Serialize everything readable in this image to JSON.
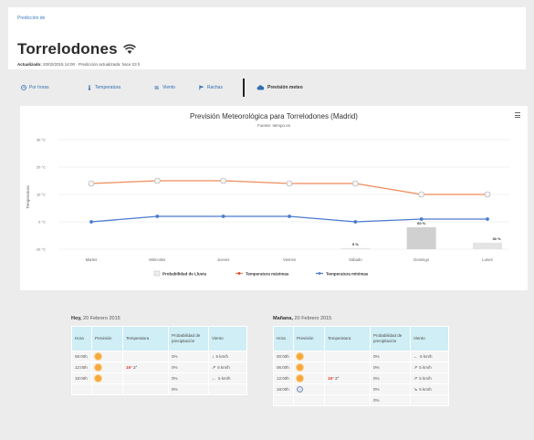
{
  "header": {
    "breadcrumb": "Predicción de",
    "title": "Torrelodones",
    "subtitle_prefix": "Actualizado: ",
    "subtitle_rest": "20/02/2015 14:00 · Predicción actualizada: hace 23 h"
  },
  "tabs": [
    {
      "label": "Por horas",
      "icon": "clock-icon"
    },
    {
      "label": "Temperatura",
      "icon": "thermometer-icon"
    },
    {
      "label": "Viento",
      "icon": "wind-icon"
    },
    {
      "label": "Rachas",
      "icon": "flag-icon"
    },
    {
      "label": "Previsión meteo",
      "icon": "cloud-icon",
      "active": true
    }
  ],
  "chart_data": {
    "type": "line",
    "title": "Previsión Meteorológica para Torrelodones (Madrid)",
    "subtitle": "Fuente: tiempo.es",
    "ylabel": "Temperatura",
    "ylim": [
      -10,
      30
    ],
    "yticks": [
      "30 °C",
      "20 °C",
      "10 °C",
      "0 °C",
      "-10 °C"
    ],
    "categories": [
      "Martes",
      "Miércoles",
      "Jueves",
      "Viernes",
      "Sábado",
      "Domingo",
      "Lunes"
    ],
    "series": [
      {
        "name": "Temperatura máximas",
        "color": "#f08b5a",
        "values": [
          14,
          15,
          15,
          14,
          14,
          10,
          10
        ]
      },
      {
        "name": "Temperatura mínimas",
        "color": "#4a7bd0",
        "values": [
          0,
          2,
          2,
          2,
          0,
          1,
          1
        ]
      }
    ],
    "precipitation": {
      "name": "Probabilidad de Lluvia",
      "values": [
        0,
        0,
        0,
        0,
        5,
        100,
        30
      ],
      "labels": [
        "",
        "",
        "",
        "",
        "5 %",
        "60 %",
        "30 %"
      ]
    },
    "grid": true,
    "legend": "bottom"
  },
  "forecast": {
    "today": {
      "title_bold": "Hoy,",
      "title_rest": " 20 Febrero 2015",
      "headers": [
        "Hora",
        "Previsión",
        "Temperatura",
        "Probabilidad de precipitación",
        "Viento"
      ],
      "rows": [
        {
          "hora": "06:00h",
          "icon": "sun-icon",
          "temp_max": "",
          "temp_min": "",
          "prob": "0%",
          "arrow": "↓",
          "wind": "5 km/h"
        },
        {
          "hora": "12:00h",
          "icon": "sun-icon",
          "temp_max": "16°",
          "temp_min": "2°",
          "prob": "0%",
          "arrow": "↗",
          "wind": "5 km/h"
        },
        {
          "hora": "18:00h",
          "icon": "sun-icon",
          "temp_max": "",
          "temp_min": "",
          "prob": "0%",
          "arrow": "←",
          "wind": "5 km/h"
        },
        {
          "hora": "",
          "icon": "",
          "temp_max": "",
          "temp_min": "",
          "prob": "0%",
          "arrow": "",
          "wind": ""
        }
      ]
    },
    "tomorrow": {
      "title_bold": "Mañana,",
      "title_rest": " 20 Febrero 2015",
      "headers": [
        "Hora",
        "Previsión",
        "Temperatura",
        "Probabilidad de precipitación",
        "Viento"
      ],
      "rows": [
        {
          "hora": "00:00h",
          "icon": "sun-icon",
          "temp_max": "",
          "temp_min": "",
          "prob": "0%",
          "arrow": "←",
          "wind": "5 km/h"
        },
        {
          "hora": "06:00h",
          "icon": "sun-icon",
          "temp_max": "",
          "temp_min": "",
          "prob": "0%",
          "arrow": "↗",
          "wind": "5 km/h"
        },
        {
          "hora": "12:00h",
          "icon": "sun-icon",
          "temp_max": "16°",
          "temp_min": "2°",
          "prob": "0%",
          "arrow": "↗",
          "wind": "5 km/h"
        },
        {
          "hora": "18:00h",
          "icon": "moon-icon",
          "temp_max": "",
          "temp_min": "",
          "prob": "0%",
          "arrow": "↘",
          "wind": "5 km/h"
        },
        {
          "hora": "",
          "icon": "",
          "temp_max": "",
          "temp_min": "",
          "prob": "0%",
          "arrow": "",
          "wind": ""
        }
      ]
    }
  }
}
